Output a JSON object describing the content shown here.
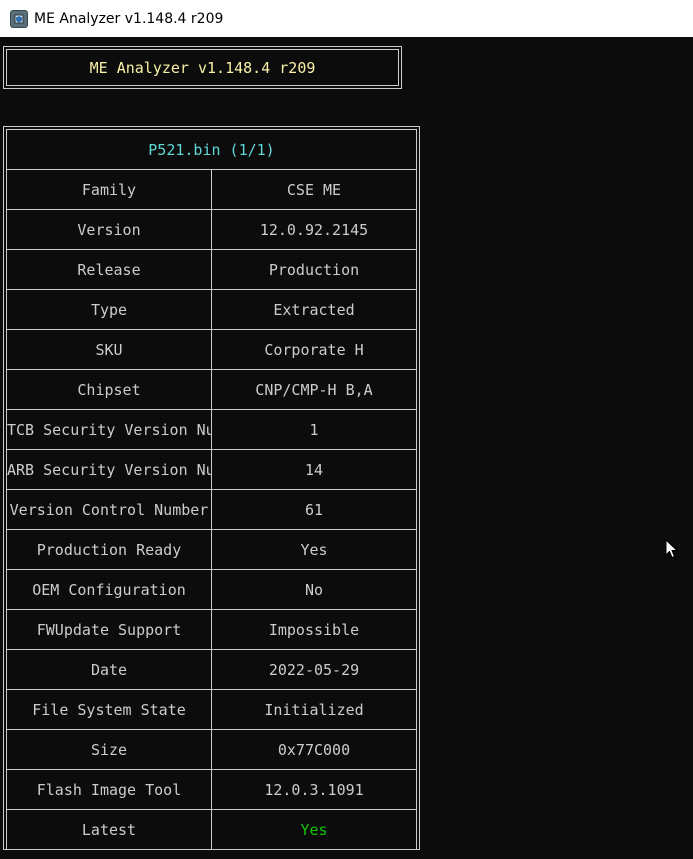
{
  "window": {
    "title": "ME Analyzer v1.148.4 r209",
    "icon": "chip-shield-icon"
  },
  "header": {
    "text": "ME Analyzer v1.148.4 r209",
    "color": "#f9f1a5"
  },
  "table": {
    "file_title": "P521.bin (1/1)",
    "rows": [
      {
        "key": "Family",
        "value": "CSE ME"
      },
      {
        "key": "Version",
        "value": "12.0.92.2145"
      },
      {
        "key": "Release",
        "value": "Production"
      },
      {
        "key": "Type",
        "value": "Extracted"
      },
      {
        "key": "SKU",
        "value": "Corporate H"
      },
      {
        "key": "Chipset",
        "value": "CNP/CMP-H B,A"
      },
      {
        "key": "TCB Security Version Number",
        "value": "1"
      },
      {
        "key": "ARB Security Version Number",
        "value": "14"
      },
      {
        "key": "Version Control Number",
        "value": "61"
      },
      {
        "key": "Production Ready",
        "value": "Yes"
      },
      {
        "key": "OEM Configuration",
        "value": "No"
      },
      {
        "key": "FWUpdate Support",
        "value": "Impossible"
      },
      {
        "key": "Date",
        "value": "2022-05-29"
      },
      {
        "key": "File System State",
        "value": "Initialized"
      },
      {
        "key": "Size",
        "value": "0x77C000"
      },
      {
        "key": "Flash Image Tool",
        "value": "12.0.3.1091"
      },
      {
        "key": "Latest",
        "value": "Yes",
        "highlight": "#16c60c"
      }
    ]
  },
  "colors": {
    "background": "#0c0c0c",
    "text": "#cccccc",
    "file_title": "#61d6d6",
    "latest_ok": "#16c60c"
  }
}
